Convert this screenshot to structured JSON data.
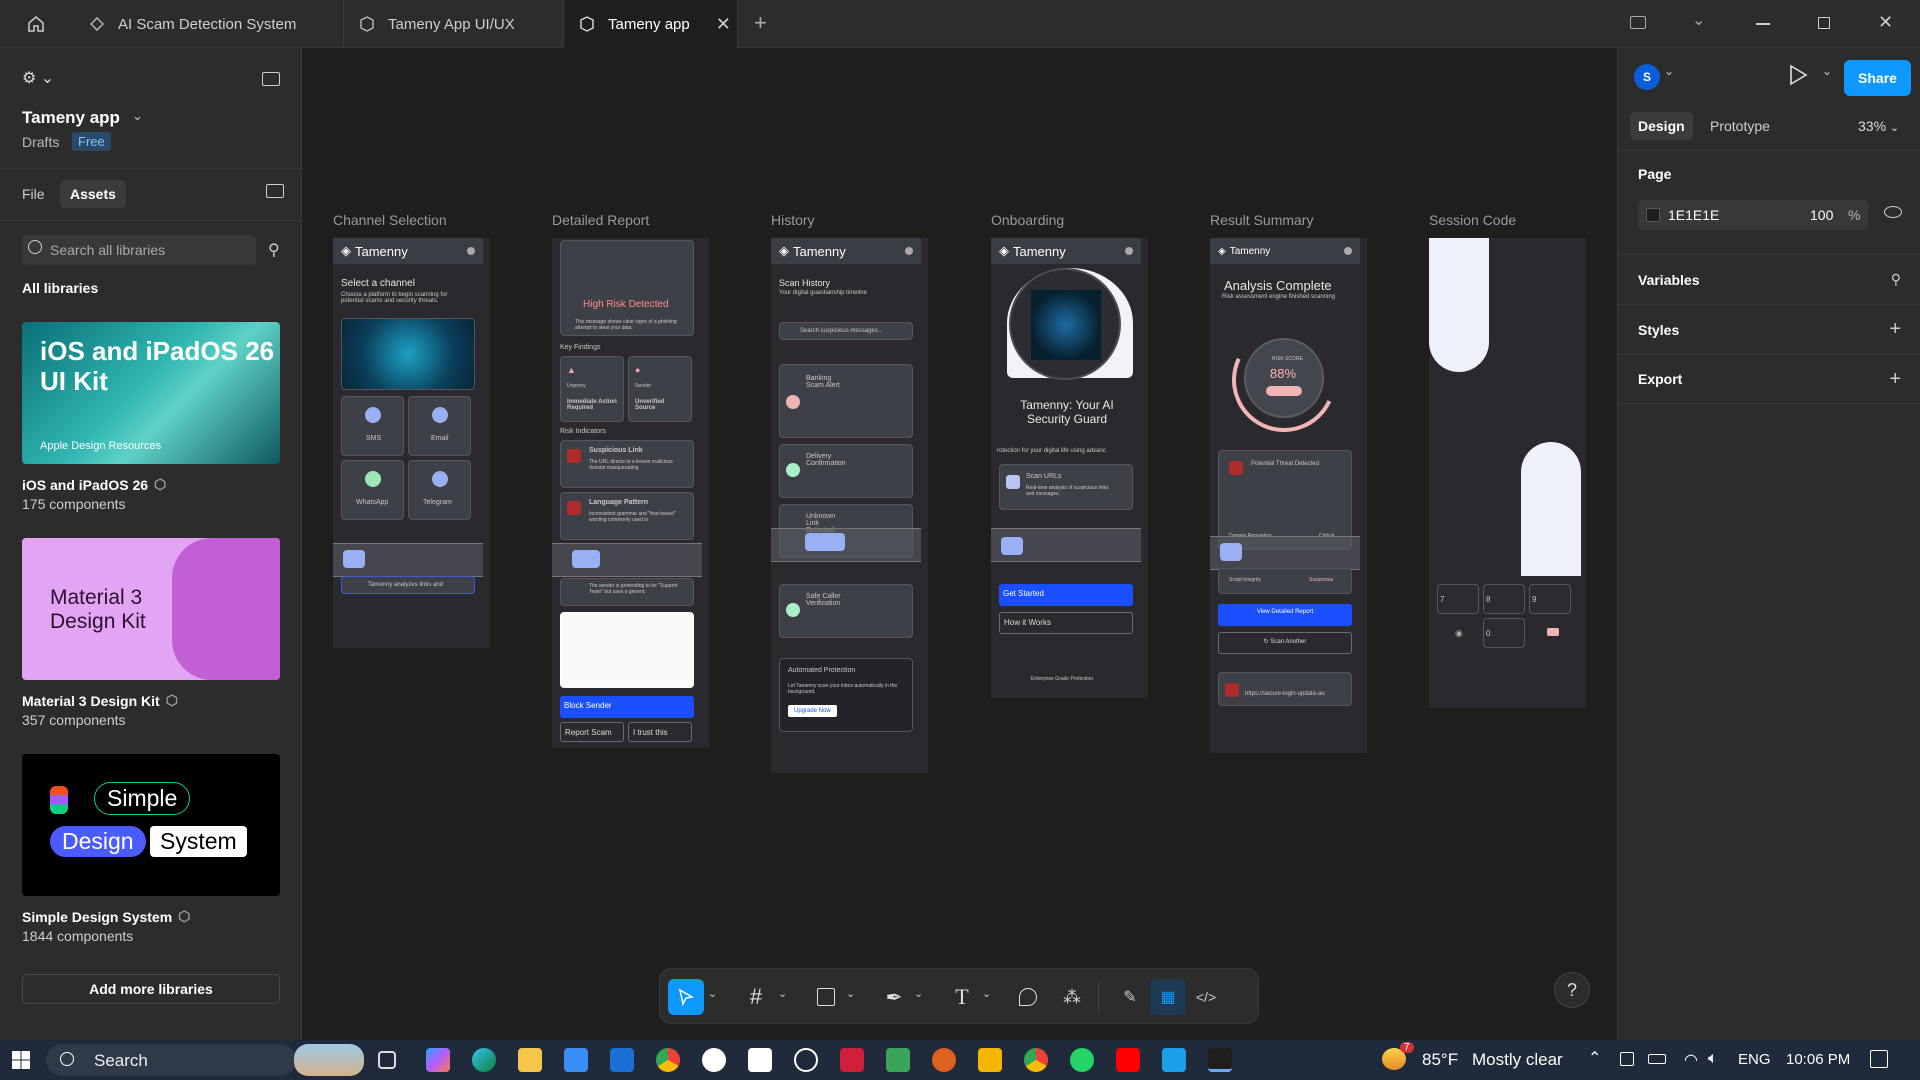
{
  "titlebar": {
    "tabs": [
      {
        "label": "AI Scam Detection System"
      },
      {
        "label": "Tameny App UI/UX"
      },
      {
        "label": "Tameny app"
      }
    ]
  },
  "left": {
    "file_name": "Tameny app",
    "location": "Drafts",
    "plan_badge": "Free",
    "tab_file": "File",
    "tab_assets": "Assets",
    "search_placeholder": "Search all libraries",
    "section_title": "All libraries",
    "libraries": [
      {
        "title": "iOS and iPadOS 26",
        "count": "175 components",
        "thumb_line1": "iOS and iPadOS 26",
        "thumb_line2": "UI Kit",
        "thumb_caption": "Apple Design Resources"
      },
      {
        "title": "Material 3 Design Kit",
        "count": "357 components",
        "thumb_line1": "Material 3",
        "thumb_line2": "Design Kit"
      },
      {
        "title": "Simple Design System",
        "count": "1844 components",
        "thumb_line1": "Simple",
        "thumb_line2": "Design",
        "thumb_line3": "System"
      }
    ],
    "add_button": "Add more libraries"
  },
  "right": {
    "avatar_initial": "S",
    "share": "Share",
    "tab_design": "Design",
    "tab_prototype": "Prototype",
    "zoom": "33%",
    "page_label": "Page",
    "page_color": "1E1E1E",
    "page_opacity": "100",
    "percent": "%",
    "variables": "Variables",
    "styles": "Styles",
    "export": "Export"
  },
  "canvas": {
    "frames": [
      {
        "label": "Channel Selection"
      },
      {
        "label": "Detailed Report"
      },
      {
        "label": "History"
      },
      {
        "label": "Onboarding"
      },
      {
        "label": "Result Summary"
      },
      {
        "label": "Session Code"
      }
    ],
    "app_name": "Tamenny",
    "channel": {
      "heading": "Select a channel",
      "sub": "Choose a platform to begin scanning for potential scams and security threats.",
      "options": [
        "SMS",
        "Email",
        "WhatsApp",
        "Telegram"
      ],
      "footer": "Tamenny analyzes links and"
    },
    "report": {
      "alert": "High Risk Detected",
      "alert_sub": "This message shows clear signs of a phishing attempt to steal your data.",
      "key_findings": "Key Findings",
      "finding1_tag": "Urgency",
      "finding1": "Immediate Action Required",
      "finding2_tag": "Sender",
      "finding2": "Unverified Source",
      "risk_indicators": "Risk Indicators",
      "ind1": "Suspicious Link",
      "ind1_sub": "The URL directs to a known malicious domain masquerading",
      "ind2": "Language Pattern",
      "ind2_sub": "Inconsistent grammar and \"fear-based\" wording commonly used in",
      "ind3_sub": "The sender is pretending to be \"Support Team\" but uses a generic",
      "block": "Block Sender",
      "report": "Report Scam",
      "trust": "I trust this"
    },
    "history": {
      "title": "Scan History",
      "sub": "Your digital guardianship timeline",
      "search": "Search suspicious messages...",
      "items": [
        "Banking Scam Alert",
        "Delivery Confirmation",
        "Unknown Link Detected",
        "Safe Caller Verification"
      ],
      "auto_title": "Automated Protection",
      "auto_sub": "Let Tamenny scan your inbox automatically in the background.",
      "upgrade": "Upgrade Now"
    },
    "onboarding": {
      "title": "Tamenny: Your AI Security Guard",
      "sub": "rotection for your digital life using advanc",
      "feature": "Scan URLs",
      "feature_sub": "Real-time analysis of suspicious links and messages.",
      "get_started": "Get Started",
      "how": "How it Works",
      "footer": "Enterprise Grade Protection"
    },
    "result": {
      "title": "Analysis Complete",
      "sub": "Risk assessment engine finished scanning",
      "score_label": "RISK SCORE",
      "score": "88%",
      "threat": "Potential Threat Detected",
      "row1": "Domain Reputation",
      "row1_val": "Critical",
      "row2": "Script Integrity",
      "row2_val": "Suspicious",
      "details": "View Detailed Report",
      "scan_another": "Scan Another",
      "url": "https://secure-login-update-au"
    },
    "session": {
      "keys": [
        "7",
        "8",
        "9",
        "0"
      ]
    }
  },
  "taskbar": {
    "search": "Search",
    "weather_temp": "85°F",
    "weather_text": "Mostly clear",
    "lang": "ENG",
    "time": "10:06 PM",
    "badge": "7"
  },
  "colors": {
    "accent": "#0d99ff",
    "canvas_bg": "#1E1E1E",
    "app_blue": "#1a4fff"
  }
}
